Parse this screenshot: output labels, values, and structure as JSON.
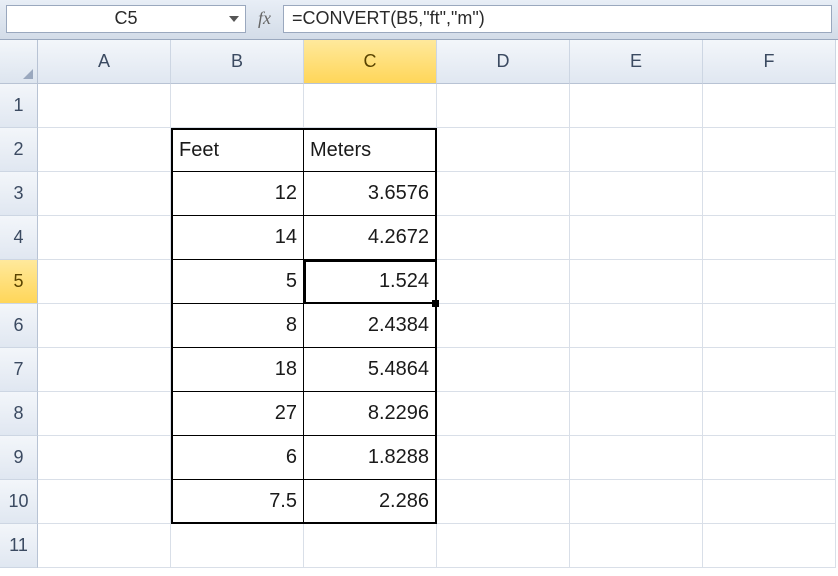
{
  "nameBox": "C5",
  "formula": "=CONVERT(B5,\"ft\",\"m\")",
  "fxLabel": "fx",
  "columns": [
    "A",
    "B",
    "C",
    "D",
    "E",
    "F"
  ],
  "rows": [
    "1",
    "2",
    "3",
    "4",
    "5",
    "6",
    "7",
    "8",
    "9",
    "10",
    "11"
  ],
  "selectedCol": "C",
  "selectedRow": "5",
  "headers": {
    "b": "Feet",
    "c": "Meters"
  },
  "data": [
    {
      "b": "12",
      "c": "3.6576"
    },
    {
      "b": "14",
      "c": "4.2672"
    },
    {
      "b": "5",
      "c": "1.524"
    },
    {
      "b": "8",
      "c": "2.4384"
    },
    {
      "b": "18",
      "c": "5.4864"
    },
    {
      "b": "27",
      "c": "8.2296"
    },
    {
      "b": "6",
      "c": "1.8288"
    },
    {
      "b": "7.5",
      "c": "2.286"
    }
  ]
}
